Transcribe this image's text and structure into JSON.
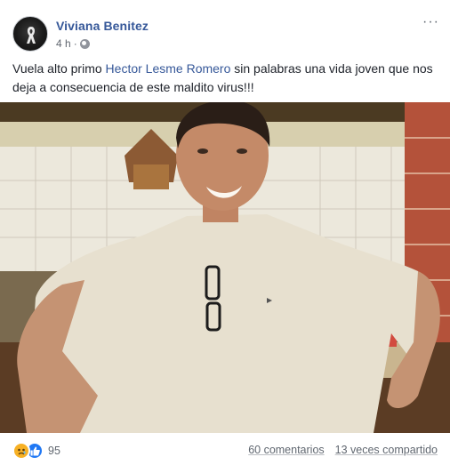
{
  "post": {
    "author": "Viviana Benitez",
    "time": "4 h",
    "separator": "·",
    "more": "···",
    "text_before": "Vuela alto primo ",
    "mention": "Hector Lesme Romero",
    "text_after": " sin palabras una vida joven que nos deja a consecuencia de este maldito virus!!!"
  },
  "icons": {
    "avatar": "mourning-ribbon-avatar",
    "privacy": "globe-icon",
    "reaction_1": "sad-reaction-icon",
    "reaction_2": "like-reaction-icon"
  },
  "footer": {
    "reaction_count": "95",
    "comments": "60 comentarios",
    "shares": "13 veces compartido"
  },
  "colors": {
    "link": "#365899",
    "meta": "#606770",
    "like": "#2078f4",
    "sad": "#f7b125"
  }
}
